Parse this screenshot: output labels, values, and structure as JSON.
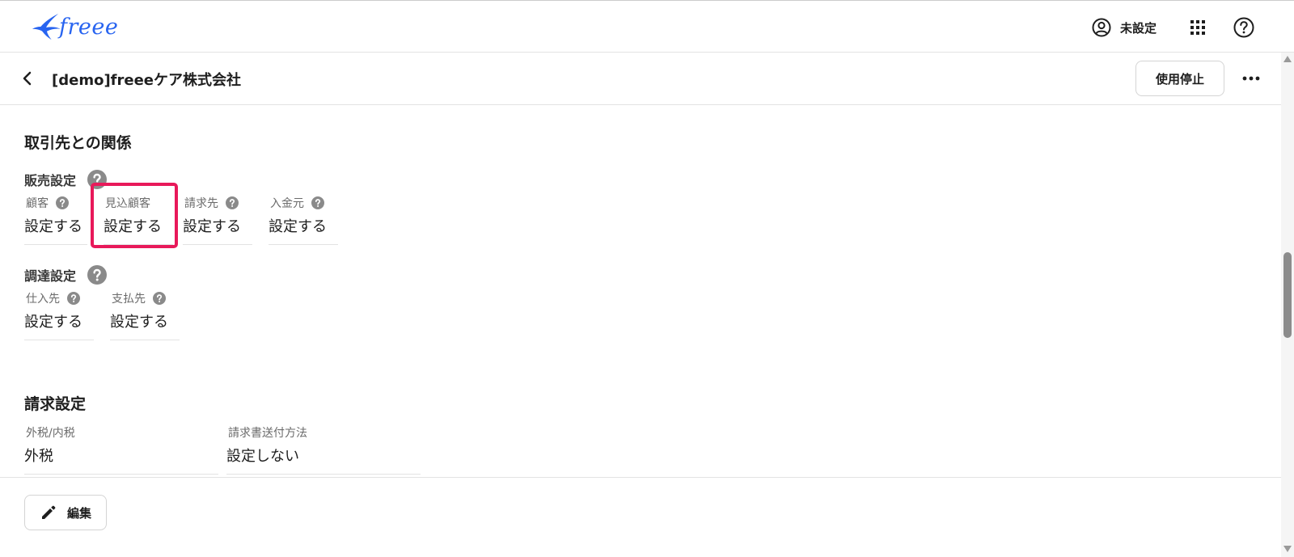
{
  "header": {
    "logo_text": "freee",
    "user_label": "未設定"
  },
  "subheader": {
    "company_name": "[demo]freeeケア株式会社",
    "stop_button": "使用停止"
  },
  "relations": {
    "title": "取引先との関係",
    "sales": {
      "title": "販売設定",
      "fields": [
        {
          "label": "顧客",
          "value": "設定する",
          "help": true
        },
        {
          "label": "見込顧客",
          "value": "設定する",
          "help": false
        },
        {
          "label": "請求先",
          "value": "設定する",
          "help": true
        },
        {
          "label": "入金元",
          "value": "設定する",
          "help": true
        }
      ]
    },
    "procurement": {
      "title": "調達設定",
      "fields": [
        {
          "label": "仕入先",
          "value": "設定する",
          "help": true
        },
        {
          "label": "支払先",
          "value": "設定する",
          "help": true
        }
      ]
    }
  },
  "billing": {
    "title": "請求設定",
    "fields": [
      {
        "label": "外税/内税",
        "value": "外税"
      },
      {
        "label": "請求書送付方法",
        "value": "設定しない"
      }
    ]
  },
  "footer": {
    "edit_button": "編集"
  },
  "colors": {
    "brand": "#2864f0",
    "highlight": "#e8195a",
    "help_icon": "#8a8a8a"
  },
  "icons": {
    "logo": "swallow-logo-icon",
    "user": "account-circle-icon",
    "apps": "apps-grid-icon",
    "help": "help-circle-icon",
    "back": "chevron-left-icon",
    "more": "more-horizontal-icon",
    "question": "question-filled-icon",
    "edit": "pencil-icon"
  }
}
